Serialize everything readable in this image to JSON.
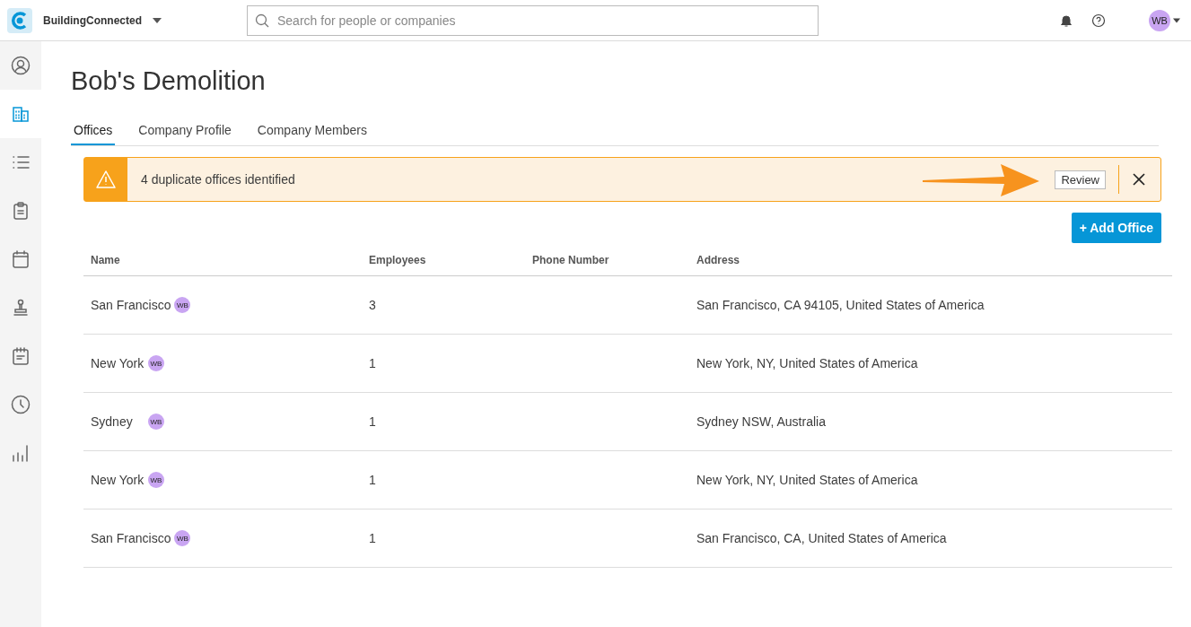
{
  "header": {
    "app_name": "BuildingConnected",
    "search": {
      "placeholder": "Search for people or companies"
    },
    "user_initials": "WB"
  },
  "sidebar": {
    "items": [
      {
        "kind": "person",
        "selected": false
      },
      {
        "kind": "building",
        "selected": true
      },
      {
        "kind": "list",
        "selected": false
      },
      {
        "kind": "clipboard",
        "selected": false
      },
      {
        "kind": "calendar",
        "selected": false
      },
      {
        "kind": "stamp",
        "selected": false
      },
      {
        "kind": "planner",
        "selected": false
      },
      {
        "kind": "clock",
        "selected": false
      },
      {
        "kind": "chart",
        "selected": false
      }
    ]
  },
  "page": {
    "title": "Bob's Demolition",
    "tabs": [
      {
        "label": "Offices",
        "selected": true
      },
      {
        "label": "Company Profile",
        "selected": false
      },
      {
        "label": "Company Members",
        "selected": false
      }
    ],
    "banner": {
      "message": "4 duplicate offices identified",
      "action": "Review"
    },
    "add_button": "+ Add Office",
    "table": {
      "columns": [
        "Name",
        "Employees",
        "Phone Number",
        "Address"
      ],
      "rows": [
        {
          "name": "San Francisco",
          "badge": "WB",
          "employees": "3",
          "phone": "",
          "address": "San Francisco, CA 94105, United States of America"
        },
        {
          "name": "New York",
          "badge": "WB",
          "employees": "1",
          "phone": "",
          "address": "New York, NY, United States of America"
        },
        {
          "name": "Sydney",
          "badge": "WB",
          "employees": "1",
          "phone": "",
          "address": "Sydney NSW, Australia"
        },
        {
          "name": "New York",
          "badge": "WB",
          "employees": "1",
          "phone": "",
          "address": "New York, NY, United States of America"
        },
        {
          "name": "San Francisco",
          "badge": "WB",
          "employees": "1",
          "phone": "",
          "address": "San Francisco, CA, United States of America"
        }
      ]
    }
  }
}
